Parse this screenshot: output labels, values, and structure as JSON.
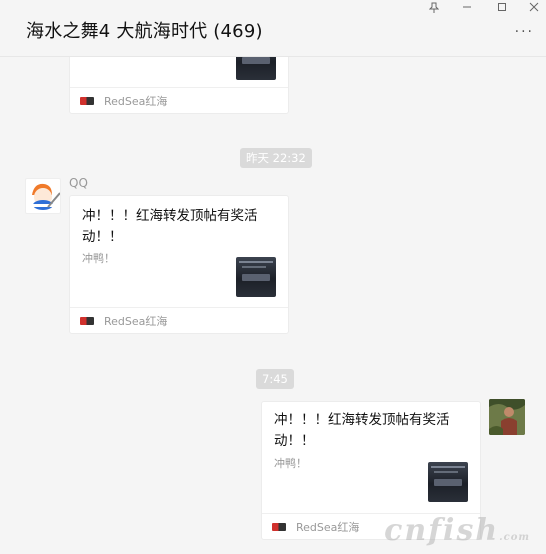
{
  "window": {
    "title": "海水之舞4 大航海时代 (469)",
    "controls": {
      "pin": "pin-icon",
      "minimize": "minimize-icon",
      "maximize": "maximize-icon",
      "close": "close-icon"
    },
    "more_label": "···"
  },
  "messages": [
    {
      "type": "card",
      "position": "left",
      "partial": true,
      "source": "RedSea红海"
    },
    {
      "type": "time",
      "label": "昨天 22:32"
    },
    {
      "type": "card",
      "position": "left",
      "sender": "QQ",
      "title_line1": "冲！！！红海转发顶帖有奖活",
      "title_line2": "动！！",
      "desc": "冲鸭！",
      "source": "RedSea红海"
    },
    {
      "type": "time",
      "label": "7:45"
    },
    {
      "type": "card",
      "position": "right",
      "title_line1": "冲！！！红海转发顶帖有奖活",
      "title_line2": "动！！",
      "desc": "冲鸭！",
      "source": "RedSea红海"
    }
  ],
  "watermark": {
    "text": "cnfish",
    "suffix": ".com"
  }
}
